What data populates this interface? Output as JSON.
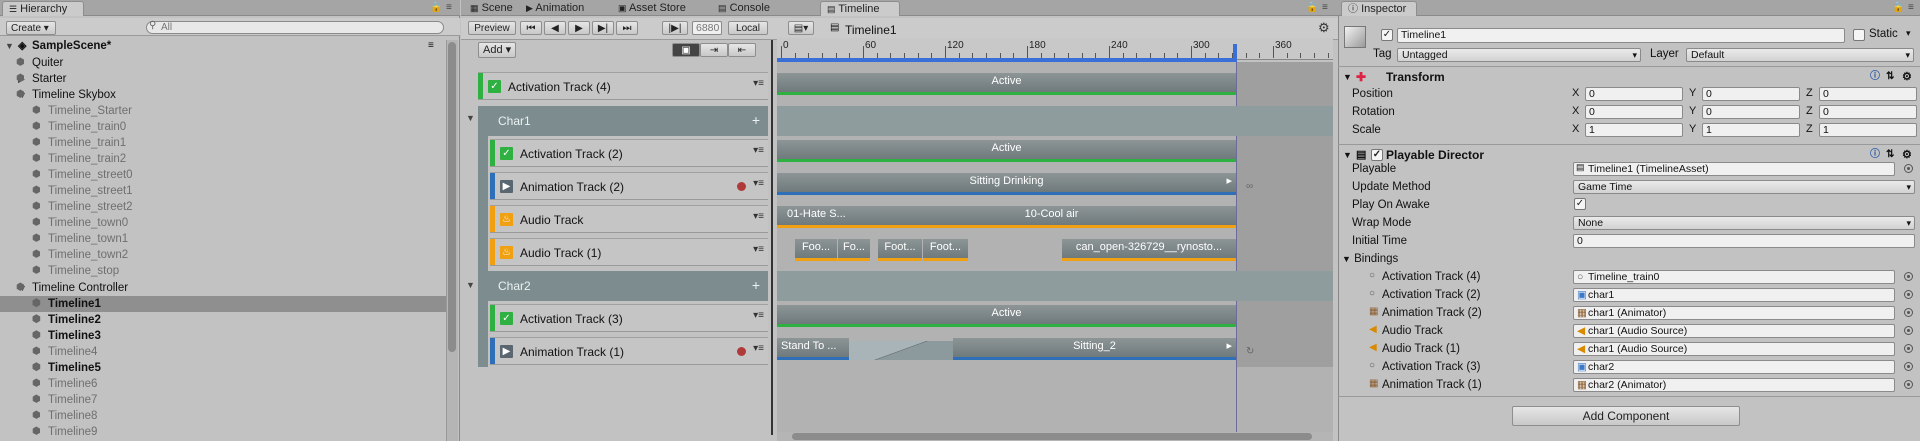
{
  "hierarchy": {
    "tab": "Hierarchy",
    "create_label": "Create",
    "search_placeholder": "All",
    "scene": "SampleScene*",
    "rows": [
      {
        "label": "Quiter",
        "dim": false
      },
      {
        "label": "Starter",
        "dim": false
      },
      {
        "label": "Timeline Skybox",
        "dim": false
      },
      {
        "label": "Timeline_Starter",
        "dim": true
      },
      {
        "label": "Timeline_train0",
        "dim": true
      },
      {
        "label": "Timeline_train1",
        "dim": true
      },
      {
        "label": "Timeline_train2",
        "dim": true
      },
      {
        "label": "Timeline_street0",
        "dim": true
      },
      {
        "label": "Timeline_street1",
        "dim": true
      },
      {
        "label": "Timeline_street2",
        "dim": true
      },
      {
        "label": "Timeline_town0",
        "dim": true
      },
      {
        "label": "Timeline_town1",
        "dim": true
      },
      {
        "label": "Timeline_town2",
        "dim": true
      },
      {
        "label": "Timeline_stop",
        "dim": true
      },
      {
        "label": "Timeline Controller",
        "dim": false
      },
      {
        "label": "Timeline1",
        "dim": false
      },
      {
        "label": "Timeline2",
        "dim": false
      },
      {
        "label": "Timeline3",
        "dim": false
      },
      {
        "label": "Timeline4",
        "dim": true
      },
      {
        "label": "Timeline5",
        "dim": false
      },
      {
        "label": "Timeline6",
        "dim": true
      },
      {
        "label": "Timeline7",
        "dim": true
      },
      {
        "label": "Timeline8",
        "dim": true
      },
      {
        "label": "Timeline9",
        "dim": true
      }
    ]
  },
  "tabs": {
    "scene": "Scene",
    "animation": "Animation",
    "asset_store": "Asset Store",
    "console": "Console",
    "timeline": "Timeline"
  },
  "timeline": {
    "preview": "Preview",
    "frame": "6880",
    "local": "Local",
    "asset_name": "Timeline1",
    "add_label": "Add",
    "ruler": [
      "0",
      "60",
      "120",
      "180",
      "240",
      "300",
      "360"
    ],
    "tracks": [
      {
        "name": "Activation Track (4)"
      },
      {
        "name": "Char1"
      },
      {
        "name": "Activation Track (2)"
      },
      {
        "name": "Animation Track (2)"
      },
      {
        "name": "Audio Track"
      },
      {
        "name": "Audio Track (1)"
      },
      {
        "name": "Char2"
      },
      {
        "name": "Activation Track (3)"
      },
      {
        "name": "Animation Track (1)"
      }
    ],
    "clips": {
      "active": "Active",
      "sitting_drinking": "Sitting Drinking",
      "hate": "01-Hate S...",
      "cool_air": "10-Cool air",
      "foo1": "Foo...",
      "fo2": "Fo...",
      "foot3": "Foot...",
      "foot4": "Foot...",
      "can_open": "can_open-326729__rynosto...",
      "stand_to": "Stand To ...",
      "sitting_2": "Sitting_2"
    }
  },
  "inspector": {
    "tab": "Inspector",
    "object_name": "Timeline1",
    "static_label": "Static",
    "tag_label": "Tag",
    "tag_value": "Untagged",
    "layer_label": "Layer",
    "layer_value": "Default",
    "transform": {
      "title": "Transform",
      "position_label": "Position",
      "rotation_label": "Rotation",
      "scale_label": "Scale",
      "position": [
        "0",
        "0",
        "0"
      ],
      "rotation": [
        "0",
        "0",
        "0"
      ],
      "scale": [
        "1",
        "1",
        "1"
      ]
    },
    "director": {
      "title": "Playable Director",
      "playable_label": "Playable",
      "playable_value": "Timeline1 (TimelineAsset)",
      "update_label": "Update Method",
      "update_value": "Game Time",
      "awake_label": "Play On Awake",
      "wrap_label": "Wrap Mode",
      "wrap_value": "None",
      "initial_label": "Initial Time",
      "initial_value": "0",
      "bindings_label": "Bindings",
      "bindings": [
        {
          "track": "Activation Track (4)",
          "value": "Timeline_train0"
        },
        {
          "track": "Activation Track (2)",
          "value": "char1"
        },
        {
          "track": "Animation Track (2)",
          "value": "char1 (Animator)"
        },
        {
          "track": "Audio Track",
          "value": "char1 (Audio Source)"
        },
        {
          "track": "Audio Track (1)",
          "value": "char1 (Audio Source)"
        },
        {
          "track": "Activation Track (3)",
          "value": "char2"
        },
        {
          "track": "Animation Track (1)",
          "value": "char2 (Animator)"
        }
      ]
    },
    "add_component": "Add Component"
  },
  "colors": {
    "activation": "#2fb142",
    "animation": "#2f6fb8",
    "audio": "#f0a010",
    "group": "#7d8d8f"
  }
}
